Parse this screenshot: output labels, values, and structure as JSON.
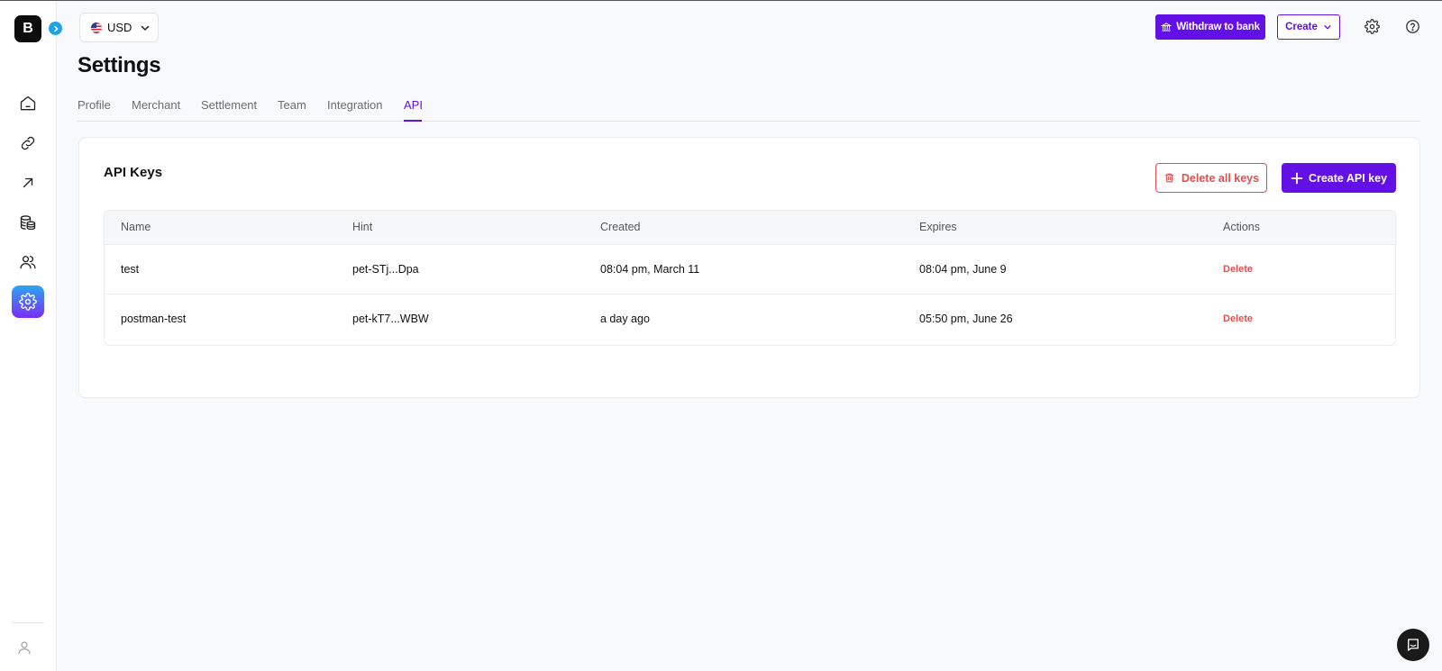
{
  "brand": {
    "logo_letter": "B"
  },
  "sidebar": {
    "items": [
      {
        "icon": "home-icon",
        "active": false
      },
      {
        "icon": "link-icon",
        "active": false
      },
      {
        "icon": "arrow-up-right-icon",
        "active": false
      },
      {
        "icon": "coins-icon",
        "active": false
      },
      {
        "icon": "users-icon",
        "active": false
      },
      {
        "icon": "gear-icon",
        "active": true
      }
    ]
  },
  "header": {
    "currency": "USD",
    "withdraw_label": "Withdraw to bank",
    "create_label": "Create"
  },
  "page": {
    "title": "Settings",
    "tabs": [
      {
        "label": "Profile",
        "active": false
      },
      {
        "label": "Merchant",
        "active": false
      },
      {
        "label": "Settlement",
        "active": false
      },
      {
        "label": "Team",
        "active": false
      },
      {
        "label": "Integration",
        "active": false
      },
      {
        "label": "API",
        "active": true
      }
    ]
  },
  "api_keys": {
    "title": "API Keys",
    "delete_all_label": "Delete all keys",
    "create_label": "Create API key",
    "columns": [
      "Name",
      "Hint",
      "Created",
      "Expires",
      "Actions"
    ],
    "rows": [
      {
        "name": "test",
        "hint": "pet-STj...Dpa",
        "created": "08:04 pm, March 11",
        "expires": "08:04 pm, June 9",
        "action": "Delete"
      },
      {
        "name": "postman-test",
        "hint": "pet-kT7...WBW",
        "created": "a day ago",
        "expires": "05:50 pm, June 26",
        "action": "Delete"
      }
    ]
  },
  "colors": {
    "accent": "#6210e6",
    "danger": "#e24d4d",
    "sidebar_active_start": "#2aa6f3",
    "sidebar_active_end": "#7b2cf5"
  }
}
